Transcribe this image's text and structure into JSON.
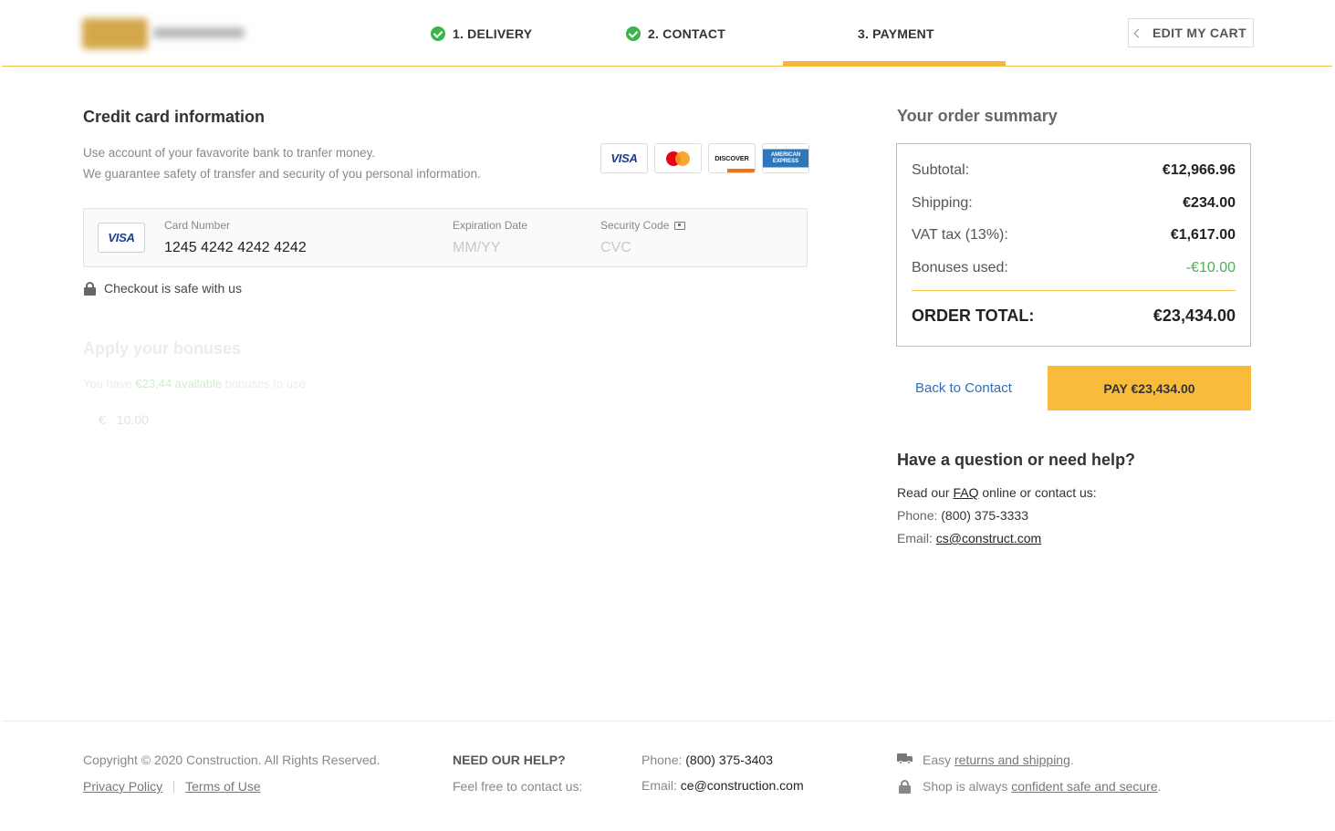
{
  "header": {
    "steps": [
      {
        "label": "1. DELIVERY",
        "done": true
      },
      {
        "label": "2. CONTACT",
        "done": true
      },
      {
        "label": "3. PAYMENT",
        "done": false,
        "active": true
      }
    ],
    "edit_cart_label": "EDIT MY CART",
    "accent_color": "#f7b733"
  },
  "credit_card": {
    "title": "Credit card information",
    "desc_line1": "Use account of your favavorite bank to tranfer money.",
    "desc_line2": "We guarantee safety of transfer and security of you personal information.",
    "brands": {
      "visa": "VISA",
      "discover": "DISCOVER",
      "amex": "AMERICAN EXPRESS"
    },
    "card_number_label": "Card Number",
    "card_number_value": "1245 4242 4242 4242",
    "expiration_label": "Expiration Date",
    "expiration_placeholder": "MM/YY",
    "security_label": "Security Code",
    "security_placeholder": "CVC",
    "safe_text": "Checkout is safe with us"
  },
  "bonuses": {
    "title": "Apply your bonuses",
    "desc_prefix": "You have ",
    "desc_amount": "€23,44 available",
    "desc_suffix": " bonuses to use.",
    "currency": "€",
    "value": "10.00"
  },
  "summary": {
    "title": "Your order summary",
    "rows": [
      {
        "label": "Subtotal:",
        "value": "€12,966.96"
      },
      {
        "label": "Shipping:",
        "value": "€234.00"
      },
      {
        "label": "VAT tax (13%):",
        "value": "€1,617.00"
      },
      {
        "label": "Bonuses used:",
        "value": "-€10.00"
      }
    ],
    "total_label": "ORDER TOTAL:",
    "total_value": "€23,434.00",
    "back_label": "Back to Contact",
    "pay_label": "PAY €23,434.00"
  },
  "help": {
    "title": "Have a question or need help?",
    "read_prefix": "Read our ",
    "faq": "FAQ",
    "read_suffix": " online or contact us:",
    "phone_label": "Phone: ",
    "phone": "(800) 375-3333",
    "email_label": "Email: ",
    "email": "cs@construct.com"
  },
  "footer": {
    "copyright": "Copyright © 2020 Construction. All Rights Reserved.",
    "privacy": "Privacy Policy",
    "terms": "Terms of Use",
    "need_help": "NEED OUR HELP?",
    "feel_free": "Feel free to contact us:",
    "phone_label": "Phone: ",
    "phone": "(800) 375-3403",
    "email_label": "Email: ",
    "email": "ce@construction.com",
    "returns_prefix": "Easy ",
    "returns_link": "returns and shipping",
    "returns_suffix": ".",
    "secure_prefix": "Shop is always ",
    "secure_link": "confident safe and secure",
    "secure_suffix": "."
  }
}
